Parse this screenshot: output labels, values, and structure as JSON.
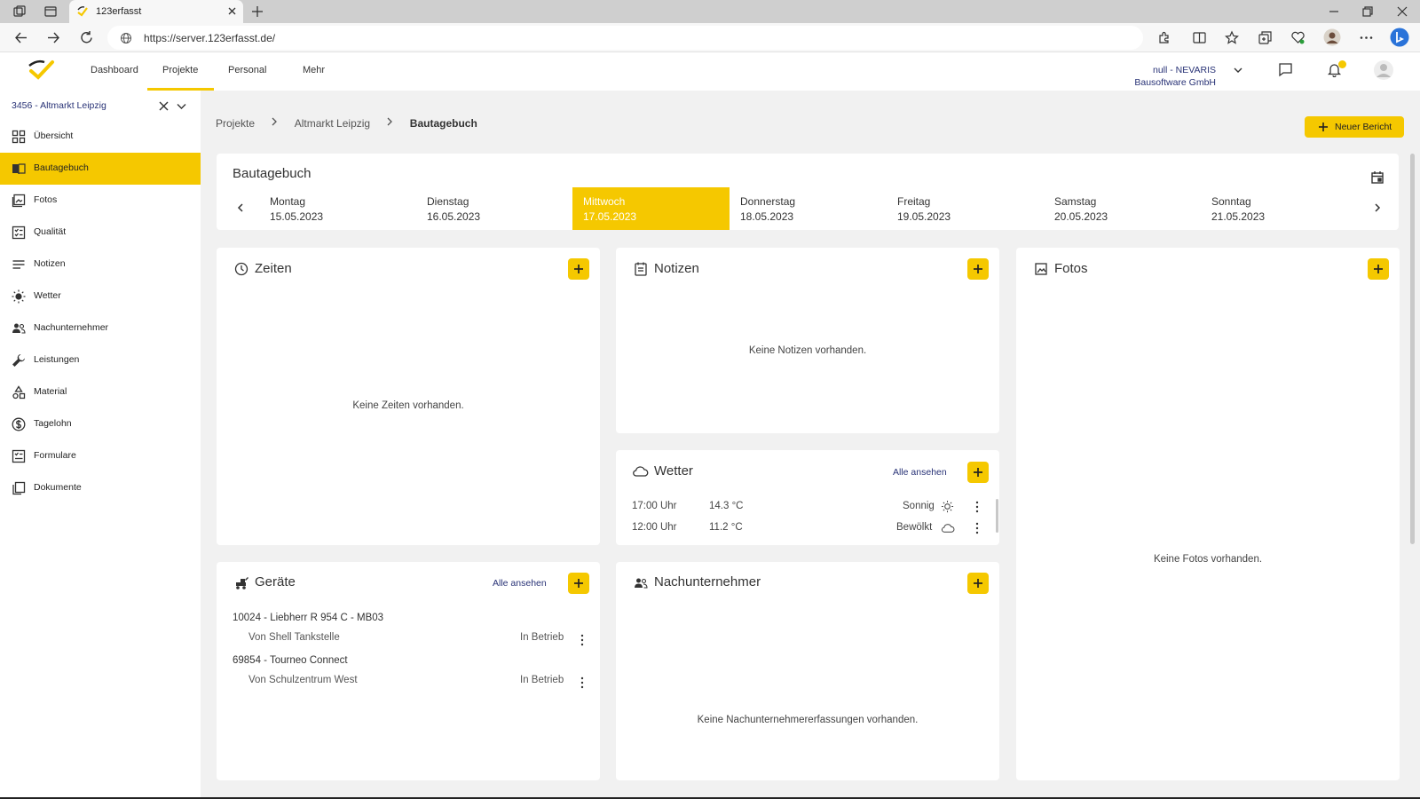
{
  "browser": {
    "tab_title": "123erfasst",
    "url": "https://server.123erfasst.de/"
  },
  "header": {
    "nav": [
      "Dashboard",
      "Projekte",
      "Personal",
      "Mehr"
    ],
    "org_line1": "null - NEVARIS",
    "org_line2": "Bausoftware GmbH"
  },
  "sidebar": {
    "project": "3456 - Altmarkt Leipzig",
    "items": [
      {
        "label": "Übersicht",
        "icon": "grid-icon"
      },
      {
        "label": "Bautagebuch",
        "icon": "book-icon"
      },
      {
        "label": "Fotos",
        "icon": "photo-icon"
      },
      {
        "label": "Qualität",
        "icon": "checklist-icon"
      },
      {
        "label": "Notizen",
        "icon": "notes-icon"
      },
      {
        "label": "Wetter",
        "icon": "sun-icon"
      },
      {
        "label": "Nachunternehmer",
        "icon": "people-icon"
      },
      {
        "label": "Leistungen",
        "icon": "wrench-icon"
      },
      {
        "label": "Material",
        "icon": "shapes-icon"
      },
      {
        "label": "Tagelohn",
        "icon": "dollar-icon"
      },
      {
        "label": "Formulare",
        "icon": "form-icon"
      },
      {
        "label": "Dokumente",
        "icon": "documents-icon"
      }
    ]
  },
  "breadcrumb": [
    "Projekte",
    "Altmarkt Leipzig",
    "Bautagebuch"
  ],
  "new_report_label": "Neuer Bericht",
  "diary": {
    "title": "Bautagebuch",
    "days": [
      {
        "name": "Montag",
        "date": "15.05.2023"
      },
      {
        "name": "Dienstag",
        "date": "16.05.2023"
      },
      {
        "name": "Mittwoch",
        "date": "17.05.2023"
      },
      {
        "name": "Donnerstag",
        "date": "18.05.2023"
      },
      {
        "name": "Freitag",
        "date": "19.05.2023"
      },
      {
        "name": "Samstag",
        "date": "20.05.2023"
      },
      {
        "name": "Sonntag",
        "date": "21.05.2023"
      }
    ],
    "selected_day": "Mittwoch"
  },
  "zeiten": {
    "title": "Zeiten",
    "empty": "Keine Zeiten vorhanden."
  },
  "notizen": {
    "title": "Notizen",
    "empty": "Keine Notizen vorhanden."
  },
  "fotos": {
    "title": "Fotos",
    "empty": "Keine Fotos vorhanden."
  },
  "wetter": {
    "title": "Wetter",
    "link": "Alle ansehen",
    "rows": [
      {
        "time": "17:00 Uhr",
        "temp": "14.3 °C",
        "condition": "Sonnig",
        "icon": "sun-icon"
      },
      {
        "time": "12:00 Uhr",
        "temp": "11.2 °C",
        "condition": "Bewölkt",
        "icon": "cloud-icon"
      }
    ]
  },
  "geraete": {
    "title": "Geräte",
    "link": "Alle ansehen",
    "items": [
      {
        "name": "10024 - Liebherr R 954 C - MB03",
        "from": "Von Shell Tankstelle",
        "status": "In Betrieb"
      },
      {
        "name": "69854 - Tourneo Connect",
        "from": "Von Schulzentrum West",
        "status": "In Betrieb"
      }
    ]
  },
  "nachunternehmer": {
    "title": "Nachunternehmer",
    "empty": "Keine Nachunternehmererfassungen vorhanden."
  },
  "colors": {
    "accent": "#f5c800",
    "link": "#283276",
    "background": "#f1f1f1"
  }
}
